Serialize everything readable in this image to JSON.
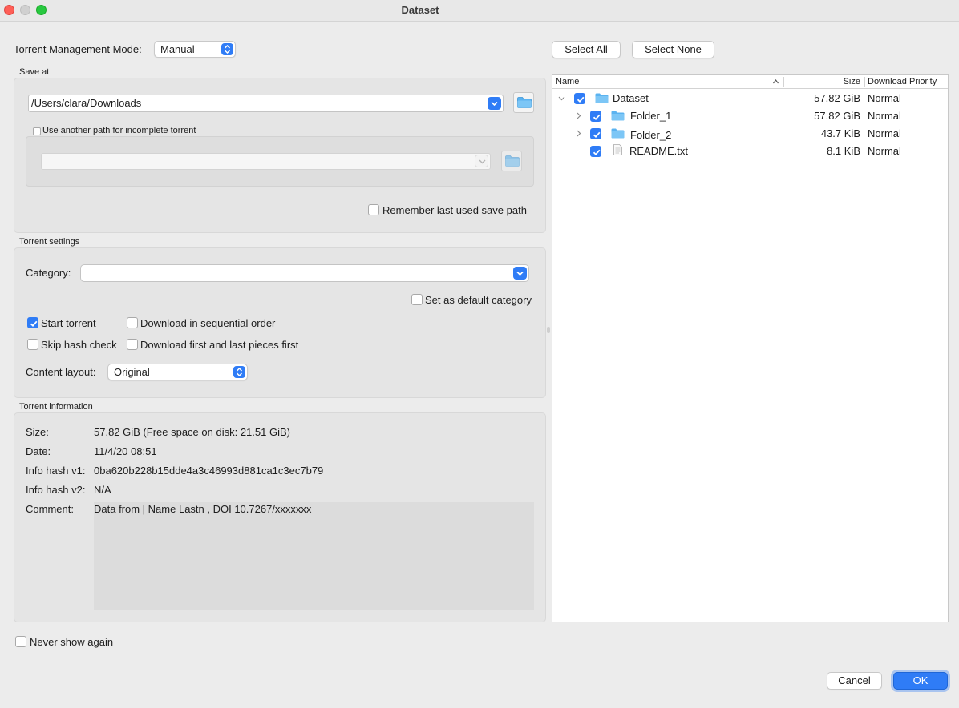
{
  "window": {
    "title": "Dataset"
  },
  "mode": {
    "label": "Torrent Management Mode:",
    "value": "Manual"
  },
  "save_at": {
    "group_title": "Save at",
    "path": "/Users/clara/Downloads",
    "use_another_path_label": "Use another path for incomplete torrent",
    "incomplete_path": "",
    "remember_label": "Remember last used save path"
  },
  "torrent_settings": {
    "group_title": "Torrent settings",
    "category_label": "Category:",
    "category_value": "",
    "default_category_label": "Set as default category",
    "start_torrent_label": "Start torrent",
    "start_torrent_checked": true,
    "sequential_label": "Download in sequential order",
    "skip_hash_label": "Skip hash check",
    "first_last_label": "Download first and last pieces first",
    "content_layout_label": "Content layout:",
    "content_layout_value": "Original"
  },
  "torrent_info": {
    "group_title": "Torrent information",
    "size_label": "Size:",
    "size_value": "57.82 GiB (Free space on disk: 21.51 GiB)",
    "date_label": "Date:",
    "date_value": "11/4/20 08:51",
    "hash_v1_label": "Info hash v1:",
    "hash_v1_value": "0ba620b228b15dde4a3c46993d881ca1c3ec7b79",
    "hash_v2_label": "Info hash v2:",
    "hash_v2_value": "N/A",
    "comment_label": "Comment:",
    "comment_value": "Data from | Name Lastn , DOI 10.7267/xxxxxxx"
  },
  "never_show_label": "Never show again",
  "selection": {
    "select_all": "Select All",
    "select_none": "Select None"
  },
  "files": {
    "columns": {
      "name": "Name",
      "size": "Size",
      "priority": "Download Priority"
    },
    "rows": [
      {
        "name": "Dataset",
        "size": "57.82 GiB",
        "priority": "Normal",
        "type": "folder",
        "checked": true,
        "expanded": true
      },
      {
        "name": "Folder_1",
        "size": "57.82 GiB",
        "priority": "Normal",
        "type": "folder",
        "checked": true,
        "expanded": false
      },
      {
        "name": "Folder_2",
        "size": "43.7 KiB",
        "priority": "Normal",
        "type": "folder",
        "checked": true,
        "expanded": false
      },
      {
        "name": "README.txt",
        "size": "8.1 KiB",
        "priority": "Normal",
        "type": "file",
        "checked": true
      }
    ]
  },
  "buttons": {
    "cancel": "Cancel",
    "ok": "OK"
  },
  "colors": {
    "accent": "#2f7cf6",
    "folder": "#5bb3f0"
  }
}
